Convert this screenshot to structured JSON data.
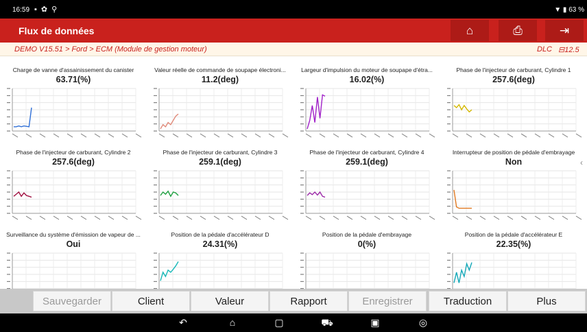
{
  "status_bar": {
    "time": "16:59",
    "battery": "63 %"
  },
  "title_bar": {
    "title": "Flux de données",
    "icons": [
      "home-icon",
      "print-icon",
      "exit-icon"
    ]
  },
  "breadcrumb": {
    "path": "DEMO V15.51 > Ford > ECM (Module de gestion moteur)",
    "dlc": "DLC",
    "voltage": "12.5"
  },
  "panels": [
    {
      "label": "Charge de vanne d'assainissement du canister",
      "value": "63.71(%)",
      "color": "#2f6fd6",
      "points": [
        0.1,
        0.1,
        0.12,
        0.1,
        0.12,
        0.11,
        0.1,
        0.55
      ]
    },
    {
      "label": "Valeur réelle de commande de soupape électroni...",
      "value": "11.2(deg)",
      "color": "#e08a7a",
      "points": [
        0.05,
        0.15,
        0.1,
        0.2,
        0.15,
        0.25,
        0.35,
        0.4
      ]
    },
    {
      "label": "Largeur d'impulsion du moteur de soupape d'étra...",
      "value": "16.02(%)",
      "color": "#a020c8",
      "points": [
        0.05,
        0.25,
        0.6,
        0.2,
        0.8,
        0.3,
        0.85,
        0.82
      ]
    },
    {
      "label": "Phase de l'injecteur de carburant, Cylindre 1",
      "value": "257.6(deg)",
      "color": "#d4b800",
      "points": [
        0.6,
        0.55,
        0.62,
        0.5,
        0.6,
        0.52,
        0.45,
        0.5
      ]
    },
    {
      "label": "Phase de l'injecteur de carburant, Cylindre 2",
      "value": "257.6(deg)",
      "color": "#a01040",
      "points": [
        0.4,
        0.45,
        0.5,
        0.4,
        0.48,
        0.42,
        0.4,
        0.38
      ]
    },
    {
      "label": "Phase de l'injecteur de carburant, Cylindre 3",
      "value": "259.1(deg)",
      "color": "#1ea040",
      "points": [
        0.42,
        0.5,
        0.45,
        0.52,
        0.4,
        0.5,
        0.48,
        0.42
      ]
    },
    {
      "label": "Phase de l'injecteur de carburant, Cylindre 4",
      "value": "259.1(deg)",
      "color": "#9c2aa8",
      "points": [
        0.42,
        0.48,
        0.44,
        0.5,
        0.43,
        0.5,
        0.4,
        0.38
      ]
    },
    {
      "label": "Interrupteur de position de pédale d'embrayage",
      "value": "Non",
      "color": "#e07820",
      "points": [
        0.55,
        0.15,
        0.12,
        0.12,
        0.12,
        0.12,
        0.12,
        0.12
      ]
    },
    {
      "label": "Surveillance du système d'émission de vapeur de ...",
      "value": "Oui",
      "color": "#3a3a3a",
      "points": []
    },
    {
      "label": "Position de la pédale d'accélérateur D",
      "value": "24.31(%)",
      "color": "#14b8b8",
      "points": [
        0.35,
        0.55,
        0.45,
        0.6,
        0.55,
        0.62,
        0.7,
        0.8
      ]
    },
    {
      "label": "Position de la pédale d'embrayage",
      "value": "0(%)",
      "color": "#3a3a3a",
      "points": []
    },
    {
      "label": "Position de la pédale d'accélérateur E",
      "value": "22.35(%)",
      "color": "#14a8b8",
      "points": [
        0.3,
        0.55,
        0.3,
        0.6,
        0.45,
        0.75,
        0.6,
        0.78
      ]
    }
  ],
  "toolbar": {
    "save": "Sauvegarder",
    "client": "Client",
    "value": "Valeur",
    "report": "Rapport",
    "record": "Enregistrer",
    "translate": "Traduction",
    "more": "Plus"
  },
  "nav_bar": {
    "icons": [
      "back-icon",
      "home-nav-icon",
      "recents-icon",
      "car-icon",
      "gallery-icon",
      "vpn-icon"
    ]
  }
}
